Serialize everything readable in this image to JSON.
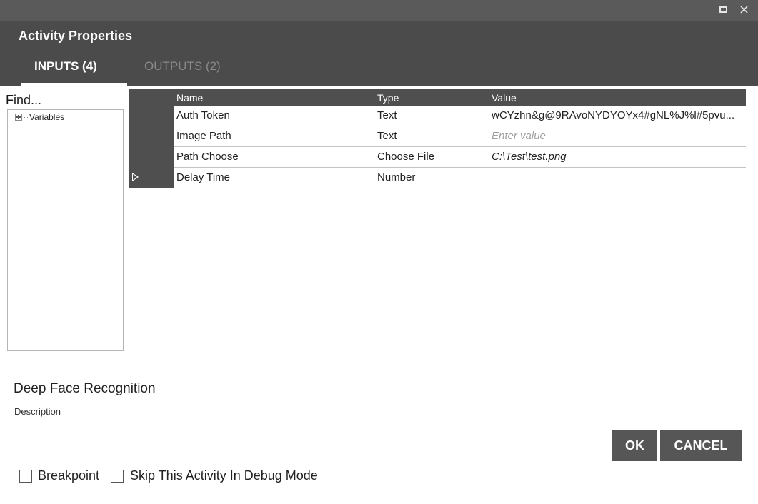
{
  "window": {
    "maximize_icon": "maximize-icon",
    "close_glyph": "×"
  },
  "dialog": {
    "title": "Activity Properties"
  },
  "tabs": [
    {
      "label": "INPUTS (4)",
      "active": true
    },
    {
      "label": "OUTPUTS (2)",
      "active": false
    }
  ],
  "variables_panel": {
    "find_label": "Find...",
    "tree": [
      {
        "label": "Variables",
        "expanded": false
      }
    ]
  },
  "grid": {
    "columns": [
      "Name",
      "Type",
      "Value"
    ],
    "rows": [
      {
        "name": "Auth Token",
        "type": "Text",
        "value": "wCYzhn&g@9RAvoNYDYOYx4#gNL%J%l#5pvu...",
        "placeholder": "",
        "current": false
      },
      {
        "name": "Image Path",
        "type": "Text",
        "value": "",
        "placeholder": "Enter value",
        "current": false
      },
      {
        "name": "Path Choose",
        "type": "Choose File",
        "value": "C:\\Test\\test.png",
        "placeholder": "",
        "current": false
      },
      {
        "name": "Delay Time",
        "type": "Number",
        "value": "",
        "placeholder": "",
        "current": true
      }
    ]
  },
  "activity": {
    "name": "Deep Face Recognition",
    "description_label": "Description"
  },
  "buttons": {
    "ok": "OK",
    "cancel": "CANCEL"
  },
  "options": {
    "breakpoint_label": "Breakpoint",
    "breakpoint_checked": false,
    "skip_label": "Skip This Activity In Debug Mode",
    "skip_checked": false
  },
  "colors": {
    "header_bg": "#4b4b4b",
    "titlebar_bg": "#5a5a5a",
    "button_bg": "#565656"
  }
}
